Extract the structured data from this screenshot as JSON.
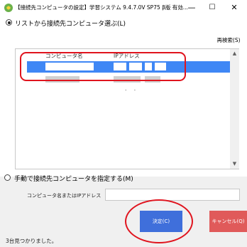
{
  "window": {
    "title": "【接続先コンピュータの設定】学習システム 9.4.7.0V SP75 β版 有効...",
    "minimize": "—",
    "maximize": "☐",
    "close": "✕"
  },
  "list_section": {
    "radio_label": "リストから接続先コンピュータ選ぶ(L)",
    "research_button": "再検索(S)",
    "columns": [
      "コンピュータ名",
      "IPアドレス"
    ],
    "rows_ip_fragment": ". ."
  },
  "manual_section": {
    "radio_label": "手動で接続先コンピュータを指定する(M)",
    "field_label": "コンピュータ名またはIPアドレス",
    "field_value": ""
  },
  "buttons": {
    "decide": "決定(C)",
    "cancel": "キャンセル(Q)"
  },
  "status": {
    "text": "3台見つかりました。"
  },
  "colors": {
    "selection": "#3f87f5",
    "decide": "#3f6fdb",
    "cancel": "#e05a5a",
    "highlight": "#e0141e"
  }
}
